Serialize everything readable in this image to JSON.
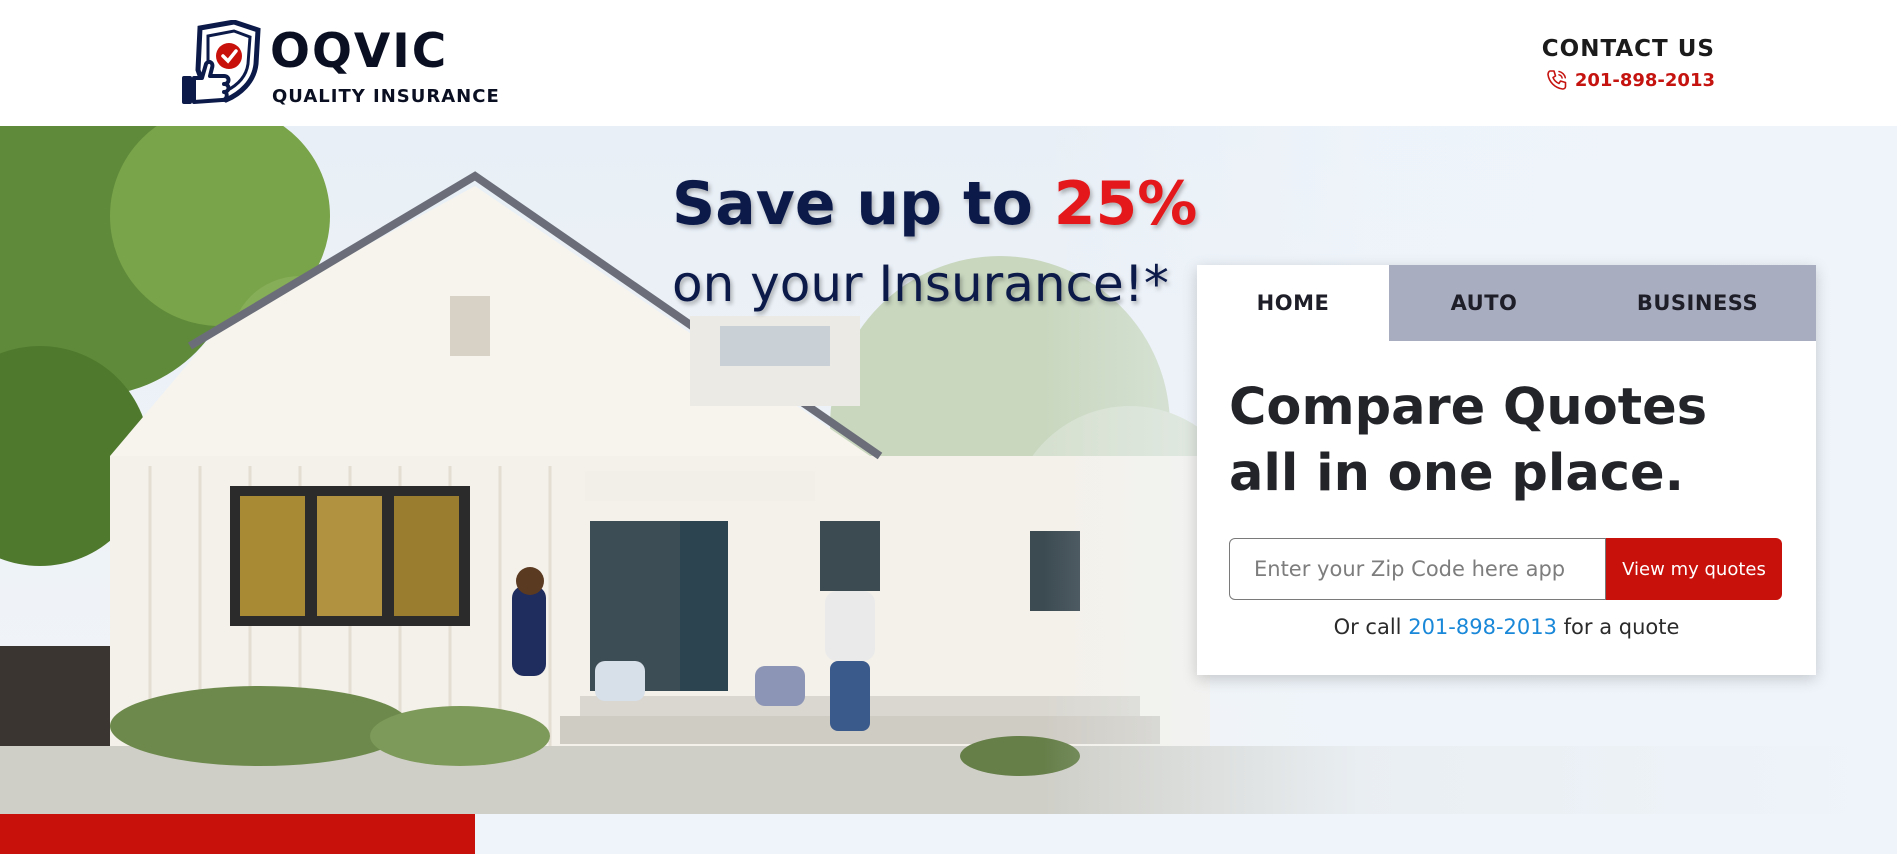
{
  "brand": {
    "name": "OQVIC",
    "tagline": "QUALITY INSURANCE",
    "logo_icon": "shield-thumbs-up-icon"
  },
  "contact": {
    "title": "CONTACT US",
    "phone": "201-898-2013",
    "phone_icon": "phone-icon"
  },
  "hero": {
    "headline_prefix": "Save up to ",
    "headline_accent": "25%",
    "headline_line2": "on your Insurance!*"
  },
  "quote_card": {
    "tabs": [
      {
        "label": "HOME",
        "active": true
      },
      {
        "label": "AUTO",
        "active": false
      },
      {
        "label": "BUSINESS",
        "active": false
      }
    ],
    "title_line1": "Compare Quotes",
    "title_line2": "all in one place.",
    "zip_placeholder": "Enter your Zip Code here app",
    "zip_value": "",
    "button_label": "View my quotes",
    "call_prefix": "Or call ",
    "call_phone": "201-898-2013",
    "call_suffix": " for a quote"
  },
  "colors": {
    "brand_red": "#c8110b",
    "accent_red": "#e4181a",
    "navy": "#0c1a4a",
    "link_blue": "#1a88d8",
    "tab_grey": "#a9adc0"
  }
}
